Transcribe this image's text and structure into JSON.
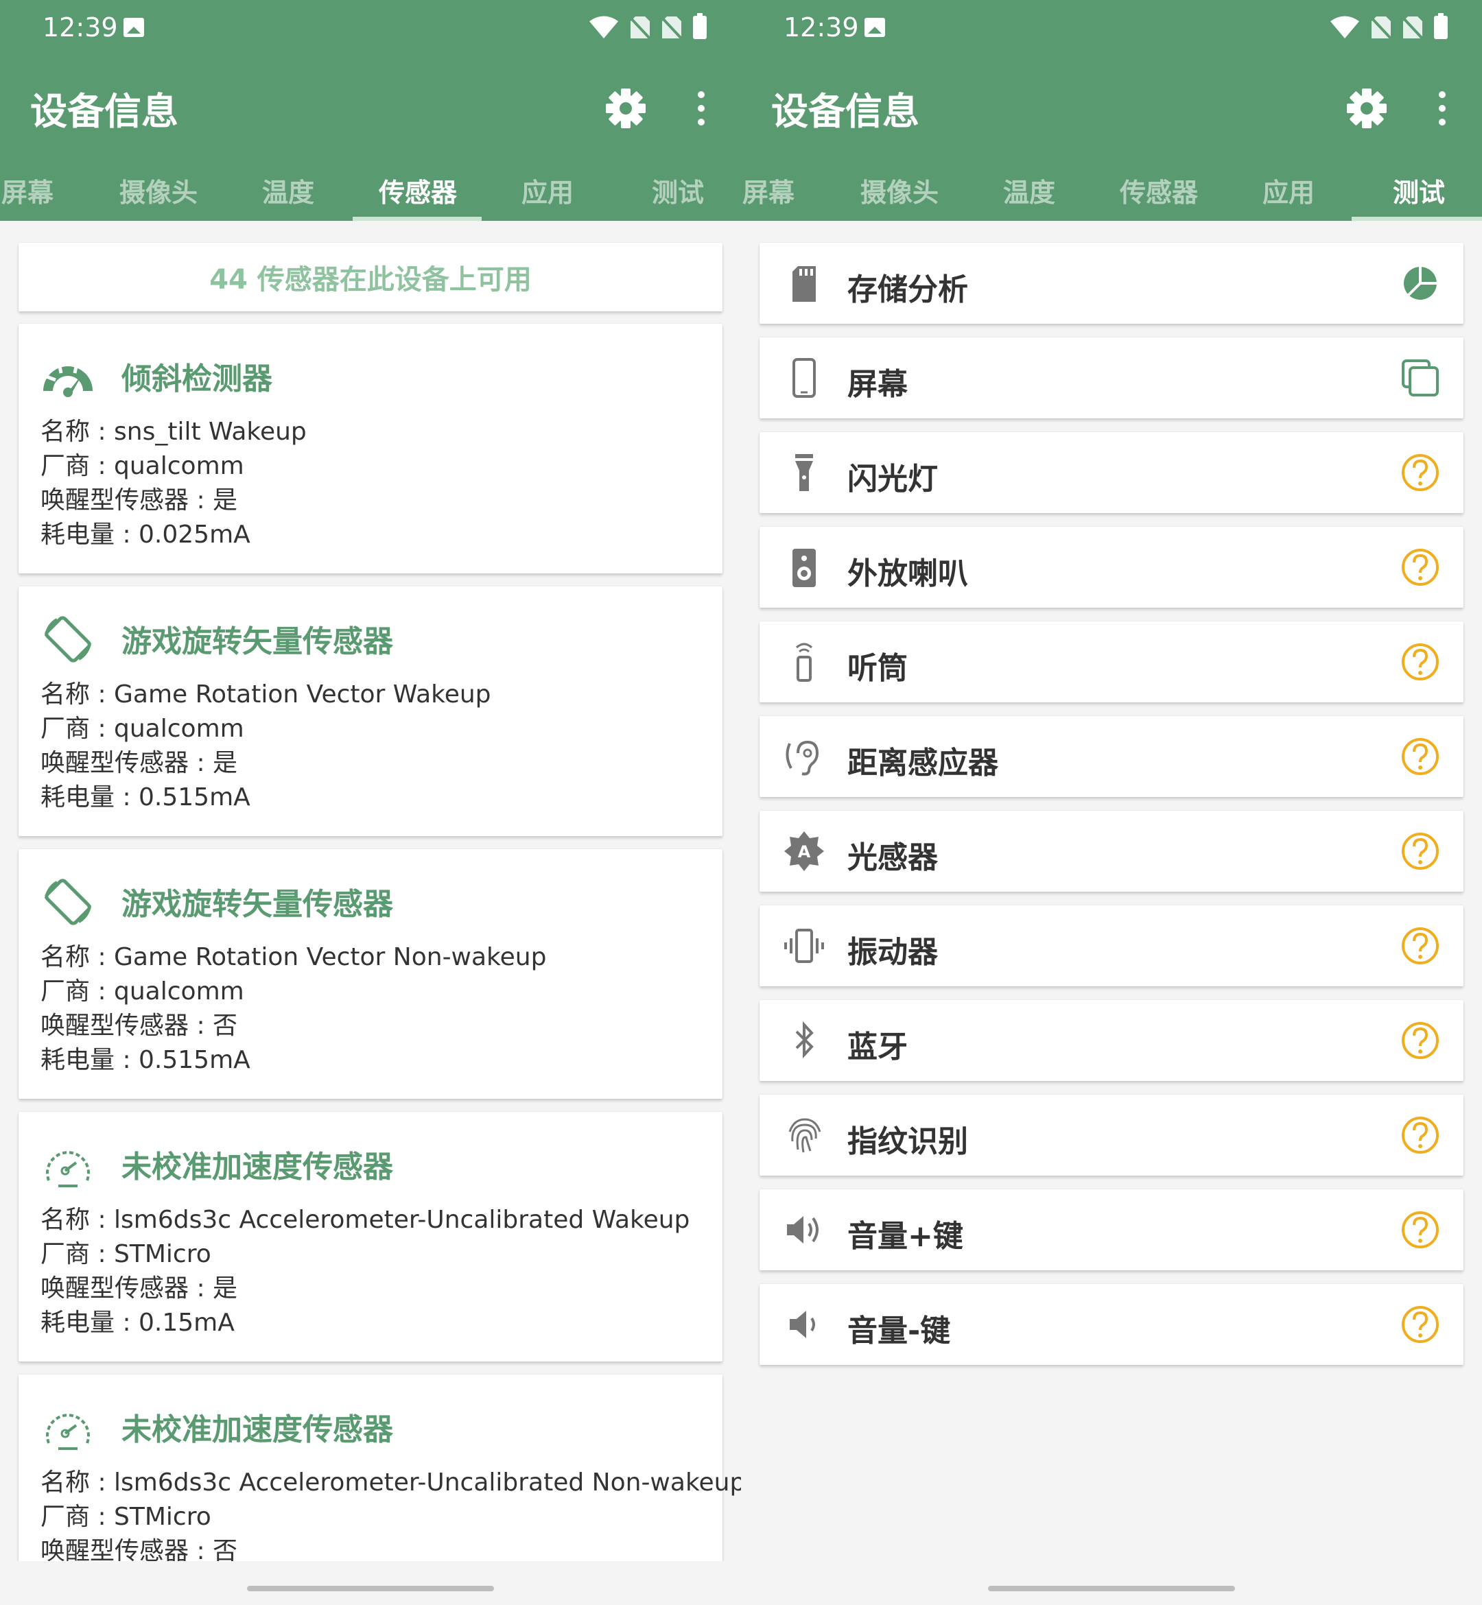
{
  "colors": {
    "primary": "#5a9a70",
    "accent_green": "#5a9a70",
    "count_text": "#8fc3a0",
    "warning": "#f0ad1e",
    "icon_gray": "#757575"
  },
  "left": {
    "status_time": "12:39",
    "app_title": "设备信息",
    "tabs": [
      "屏幕",
      "摄像头",
      "温度",
      "传感器",
      "应用",
      "测试"
    ],
    "active_tab": "传感器",
    "sensor_count": "44 传感器在此设备上可用",
    "sensors": [
      {
        "icon": "gauge-icon",
        "title": "倾斜检测器",
        "name": "名称 : sns_tilt  Wakeup",
        "vendor": "厂商 : qualcomm",
        "wakeup": "唤醒型传感器 : 是",
        "power": "耗电量 : 0.025mA"
      },
      {
        "icon": "screen-rotation-icon",
        "title": "游戏旋转矢量传感器",
        "name": "名称 : Game Rotation Vector  Wakeup",
        "vendor": "厂商 : qualcomm",
        "wakeup": "唤醒型传感器 : 是",
        "power": "耗电量 : 0.515mA"
      },
      {
        "icon": "screen-rotation-icon",
        "title": "游戏旋转矢量传感器",
        "name": "名称 : Game Rotation Vector  Non-wakeup",
        "vendor": "厂商 : qualcomm",
        "wakeup": "唤醒型传感器 : 否",
        "power": "耗电量 : 0.515mA"
      },
      {
        "icon": "speedometer-icon",
        "title": "未校准加速度传感器",
        "name": "名称 : lsm6ds3c Accelerometer-Uncalibrated Wakeup",
        "vendor": "厂商 : STMicro",
        "wakeup": "唤醒型传感器 : 是",
        "power": "耗电量 : 0.15mA"
      },
      {
        "icon": "speedometer-icon",
        "title": "未校准加速度传感器",
        "name": "名称 : lsm6ds3c Accelerometer-Uncalibrated Non-wakeup",
        "vendor": "厂商 : STMicro",
        "wakeup": "唤醒型传感器 : 否",
        "power": ""
      }
    ]
  },
  "right": {
    "status_time": "12:39",
    "app_title": "设备信息",
    "tabs": [
      "屏幕",
      "摄像头",
      "温度",
      "传感器",
      "应用",
      "测试"
    ],
    "active_tab": "测试",
    "tests": [
      {
        "icon": "sd-card-icon",
        "label": "存储分析",
        "status_icon": "pie-chart-icon"
      },
      {
        "icon": "phone-icon",
        "label": "屏幕",
        "status_icon": "copy-screens-icon"
      },
      {
        "icon": "flashlight-icon",
        "label": "闪光灯",
        "status_icon": "help-circle-icon"
      },
      {
        "icon": "speaker-icon",
        "label": "外放喇叭",
        "status_icon": "help-circle-icon"
      },
      {
        "icon": "earpiece-icon",
        "label": "听筒",
        "status_icon": "help-circle-icon"
      },
      {
        "icon": "hearing-icon",
        "label": "距离感应器",
        "status_icon": "help-circle-icon"
      },
      {
        "icon": "brightness-auto-icon",
        "label": "光感器",
        "status_icon": "help-circle-icon"
      },
      {
        "icon": "vibration-icon",
        "label": "振动器",
        "status_icon": "help-circle-icon"
      },
      {
        "icon": "bluetooth-icon",
        "label": "蓝牙",
        "status_icon": "help-circle-icon"
      },
      {
        "icon": "fingerprint-icon",
        "label": "指纹识别",
        "status_icon": "help-circle-icon"
      },
      {
        "icon": "volume-up-icon",
        "label": "音量+键",
        "status_icon": "help-circle-icon"
      },
      {
        "icon": "volume-down-icon",
        "label": "音量-键",
        "status_icon": "help-circle-icon"
      }
    ]
  }
}
